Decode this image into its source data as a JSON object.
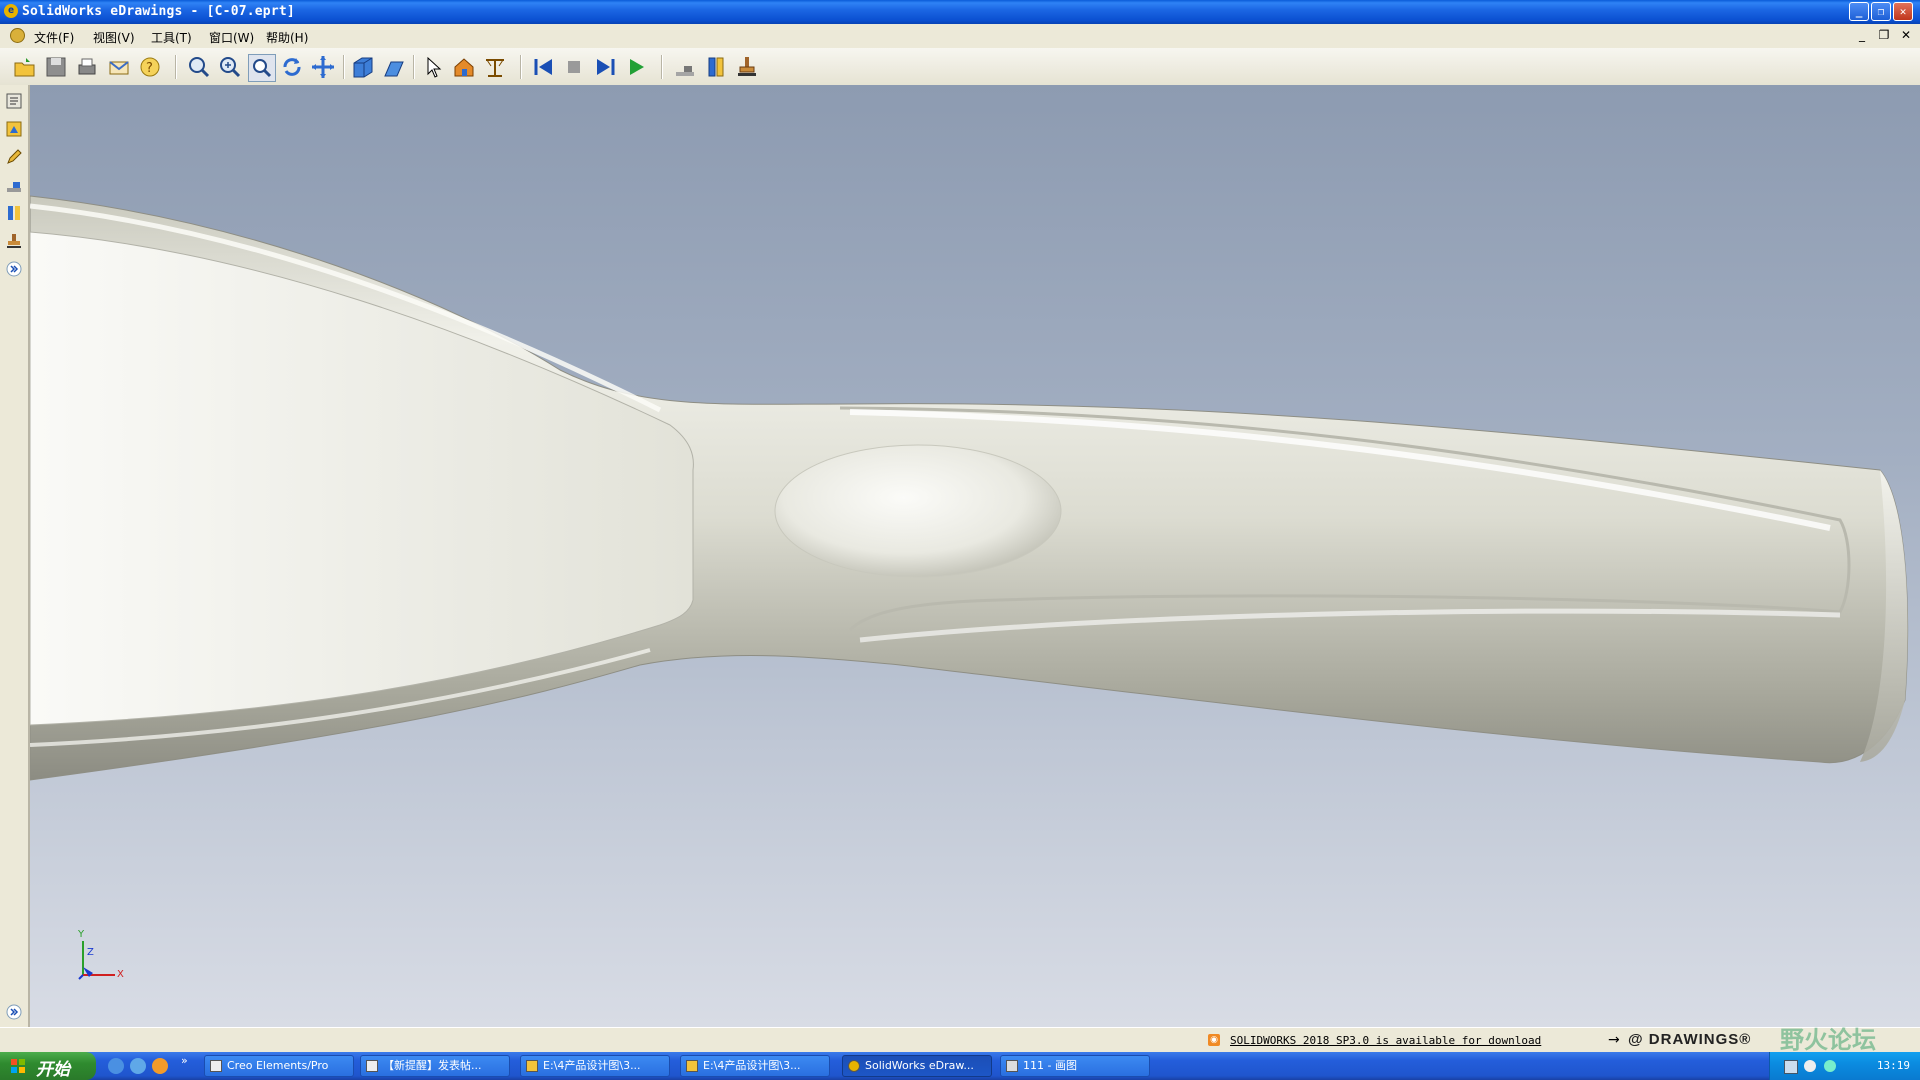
{
  "window": {
    "title": "SolidWorks eDrawings - [C-07.eprt]",
    "controls": [
      "minimize-icon",
      "restore-icon",
      "close-icon"
    ]
  },
  "menubar": {
    "items": [
      "文件(F)",
      "视图(V)",
      "工具(T)",
      "窗口(W)",
      "帮助(H)"
    ]
  },
  "toolbar": {
    "buttons": [
      "open-icon",
      "save-icon",
      "print-icon",
      "send-icon",
      "help-icon",
      "zoom-fit-icon",
      "zoom-in-out-icon",
      "zoom-area-icon",
      "rotate-icon",
      "pan-icon",
      "3d-view-icon",
      "shaded-icon",
      "select-icon",
      "home-icon",
      "measure-icon",
      "first-frame-icon",
      "stop-icon",
      "next-frame-icon",
      "play-icon",
      "cross-section-icon",
      "explode-icon",
      "stamp-icon"
    ]
  },
  "leftpanel": {
    "buttons": [
      "components-icon",
      "configurations-icon",
      "markup-icon",
      "section-icon",
      "explode-icon",
      "stamp-icon",
      "expand-icon"
    ]
  },
  "status": {
    "notice": "SOLIDWORKS 2018 SP3.0 is available for download",
    "brand": "DRAWINGS",
    "watermark": "野火论坛"
  },
  "taskbar": {
    "start": "开始",
    "tasks": [
      "Creo Elements/Pro",
      "【新提醒】发表帖...",
      "E:\\4产品设计图\\3...",
      "E:\\4产品设计图\\3...",
      "SolidWorks eDraw...",
      "111 - 画图"
    ],
    "clock": "13:19"
  },
  "triad": {
    "y_label": "Y",
    "x_label": "X",
    "z_label": "Z"
  }
}
